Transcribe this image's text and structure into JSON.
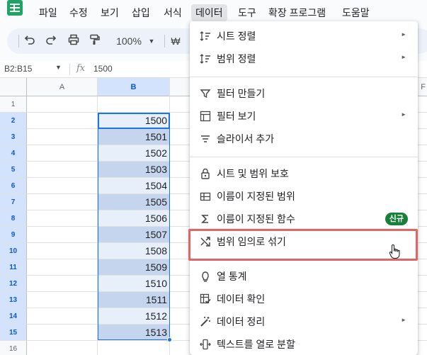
{
  "menubar": {
    "items": [
      "파일",
      "수정",
      "보기",
      "삽입",
      "서식",
      "데이터",
      "도구",
      "확장 프로그램",
      "도움말"
    ],
    "active_index": 5
  },
  "toolbar": {
    "undo_icon": "undo-icon",
    "redo_icon": "redo-icon",
    "print_icon": "print-icon",
    "paint_icon": "paint-format-icon",
    "zoom": "100%",
    "currency": "₩"
  },
  "formula_bar": {
    "name_box": "B2:B15",
    "fx": "fx",
    "value": "1500"
  },
  "grid": {
    "columns": [
      "A",
      "B",
      "F"
    ],
    "rows": [
      {
        "num": "1",
        "b": ""
      },
      {
        "num": "2",
        "b": "1500"
      },
      {
        "num": "3",
        "b": "1501"
      },
      {
        "num": "4",
        "b": "1502"
      },
      {
        "num": "5",
        "b": "1503"
      },
      {
        "num": "6",
        "b": "1504"
      },
      {
        "num": "7",
        "b": "1505"
      },
      {
        "num": "8",
        "b": "1506"
      },
      {
        "num": "9",
        "b": "1507"
      },
      {
        "num": "10",
        "b": "1508"
      },
      {
        "num": "11",
        "b": "1509"
      },
      {
        "num": "12",
        "b": "1510"
      },
      {
        "num": "13",
        "b": "1511"
      },
      {
        "num": "14",
        "b": "1512"
      },
      {
        "num": "15",
        "b": "1513"
      },
      {
        "num": "16",
        "b": ""
      }
    ]
  },
  "data_menu": {
    "items": [
      {
        "label": "시트 정렬",
        "icon": "sort-icon",
        "submenu": true
      },
      {
        "label": "범위 정렬",
        "icon": "sort-range-icon",
        "submenu": true
      },
      {
        "label": "필터 만들기",
        "icon": "filter-icon",
        "submenu": false
      },
      {
        "label": "필터 보기",
        "icon": "filter-view-icon",
        "submenu": true
      },
      {
        "label": "슬라이서 추가",
        "icon": "slicer-icon",
        "submenu": false
      },
      {
        "label": "시트 및 범위 보호",
        "icon": "lock-icon",
        "submenu": false
      },
      {
        "label": "이름이 지정된 범위",
        "icon": "named-range-icon",
        "submenu": false
      },
      {
        "label": "이름이 지정된 함수",
        "icon": "sigma-icon",
        "submenu": false,
        "badge": "신규"
      },
      {
        "label": "범위 임의로 섞기",
        "icon": "shuffle-icon",
        "submenu": false,
        "highlighted": true
      },
      {
        "label": "열 통계",
        "icon": "lightbulb-icon",
        "submenu": false
      },
      {
        "label": "데이터 확인",
        "icon": "data-validation-icon",
        "submenu": false
      },
      {
        "label": "데이터 정리",
        "icon": "magic-wand-icon",
        "submenu": true
      },
      {
        "label": "텍스트를 열로 분할",
        "icon": "split-columns-icon",
        "submenu": false
      }
    ]
  },
  "colors": {
    "accent": "#1a73e8",
    "highlight_border": "#e06666",
    "badge": "#188038",
    "logo": "#1fa463"
  }
}
